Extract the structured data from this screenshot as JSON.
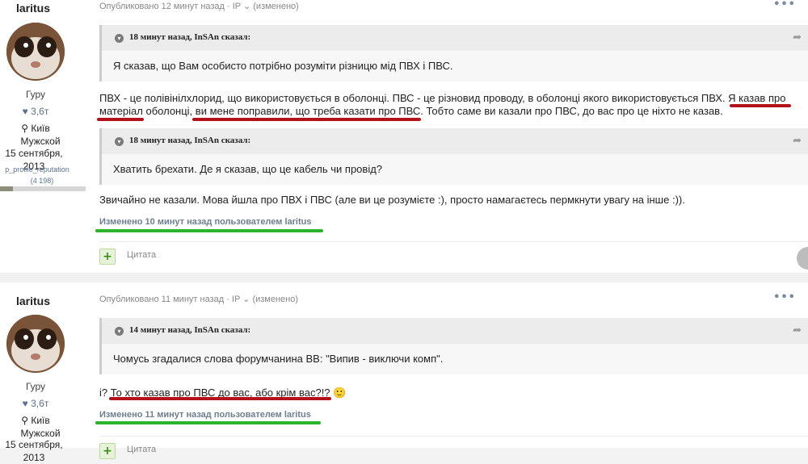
{
  "posts": [
    {
      "author": "laritus",
      "rank": "Гуру",
      "reputation": "3,6т",
      "location": "Київ",
      "gender": "Мужской",
      "joined": "15 сентября, 2013",
      "rep_label": "p_profile_reputation",
      "rep_count": "(4 198)",
      "rep_fill": 0.15,
      "meta": "Опубликовано 12 минут назад · IP ⌄ (изменено)",
      "quote1_title": "18 минут назад, InSAn сказал:",
      "quote1_text": "Я сказав, що Вам особисто потрібно розуміти різницю мід ПВХ і ПВС.",
      "para1_line1": "ПВХ - це полівінілхлорид, що використовується в оболонці. ПВС - це різновид проводу, в оболонці якого використовується ПВХ. Я казав про",
      "para1_line2": "матеріал оболонці, ви мене поправили, що треба казати про ПВС. Тобто саме ви казали про ПВС, до вас про це ніхто не казав.",
      "quote2_title": "18 минут назад, InSAn сказал:",
      "quote2_text": "Хватить брехати. Де я сказав, що це кабель чи провід?",
      "para2": "Звичайно не казали. Мова йшла про ПВХ і ПВС (але ви це розумієте :), просто намагаєтесь пермкнути увагу на інше :)).",
      "edited": "Изменено 10 минут назад пользователем laritus",
      "cite": "Цитата"
    },
    {
      "author": "laritus",
      "rank": "Гуру",
      "reputation": "3,6т",
      "location": "Київ",
      "gender": "Мужской",
      "joined": "15 сентября, 2013",
      "meta": "Опубликовано 11 минут назад · IP ⌄ (изменено)",
      "quote1_title": "14 минут назад, InSAn сказал:",
      "quote1_text": "Чомусь згадалися слова форумчанина ВВ: \"Випив - виключи комп\".",
      "para1": "і? То хто казав про ПВС до вас, або крім вас?!? 🙂",
      "edited": "Изменено 11 минут назад пользователем laritus",
      "cite": "Цитата"
    }
  ],
  "icons": {
    "dots": "more-dots-icon",
    "toggle": "quote-toggle-icon",
    "share": "share-icon",
    "plus": "plus-icon",
    "location": "location-pin-icon",
    "rep": "reputation-icon"
  },
  "colors": {
    "red_underline": "#b3121c",
    "green_underline": "#2cb32c"
  }
}
